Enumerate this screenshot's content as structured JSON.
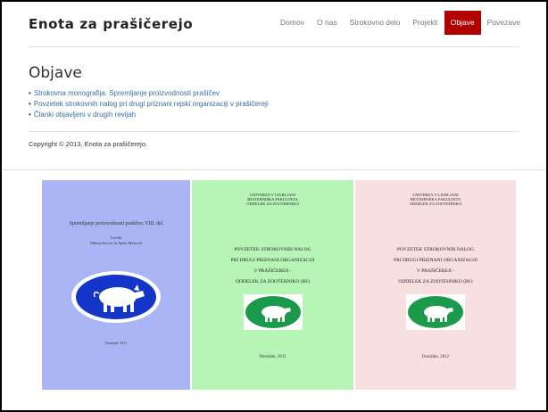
{
  "site": {
    "title": "Enota za prašičerejo"
  },
  "nav": {
    "items": [
      {
        "label": "Domov",
        "active": false
      },
      {
        "label": "O nas",
        "active": false
      },
      {
        "label": "Strokovno delo",
        "active": false
      },
      {
        "label": "Projekti",
        "active": false
      },
      {
        "label": "Objave",
        "active": true
      },
      {
        "label": "Povezave",
        "active": false
      }
    ],
    "active_color": "#b00000"
  },
  "main": {
    "heading": "Objave",
    "links": [
      "Strokovna monografija: Spremljanje proizvodnosti prašičev",
      "Povzetek strokovnih nalog pri drugi priznani rejski organizaciji v prašičereji",
      "Članki objavljeni v drugih revijah"
    ]
  },
  "footer": {
    "copyright": "Copyright © 2013, Enota za prašičerejo."
  },
  "covers": [
    {
      "bg": "#a9b5f5",
      "title": "Spremljanje proizvodnosti prašičev, VIII. del",
      "editors_1": "Uredili",
      "editors_2": "Milena Kovač in Špela Malovrh",
      "place": "Domžale, 2011",
      "icon": "pig-logo-icon"
    },
    {
      "bg": "#b6f5b6",
      "uni_1": "UNIVERZA V LJUBLJANI",
      "uni_2": "BIOTEHNIŠKA FAKULTETA",
      "uni_3": "ODDELEK ZA ZOOTEHNIKO",
      "line_1": "POVZETEK STROKOVNIH NALOG",
      "line_2": "PRI DRUGI PRIZNANI ORGANIZACIJI",
      "line_3": "V PRAŠIČEREJI -",
      "line_4": "ODDELEK ZA ZOOTEHNIKO (BF)",
      "place": "Domžale, 2011",
      "icon": "pig-logo-icon"
    },
    {
      "bg": "#f9e0e0",
      "uni_1": "UNIVERZA V LJUBLJANI",
      "uni_2": "BIOTEHNIŠKA FAKULTETA",
      "uni_3": "ODDELEK ZA ZOOTEHNIKO",
      "line_1": "POVZETEK STROKOVNIH NALOG",
      "line_2": "PRI DRUGI PRIZNANI ORGANIZACIJI",
      "line_3": "V PRAŠIČEREJI -",
      "line_4": "ODDELEK ZA ZOOTEHNIKO (BF)",
      "place": "Domžale, 2012",
      "icon": "pig-logo-icon"
    }
  ]
}
